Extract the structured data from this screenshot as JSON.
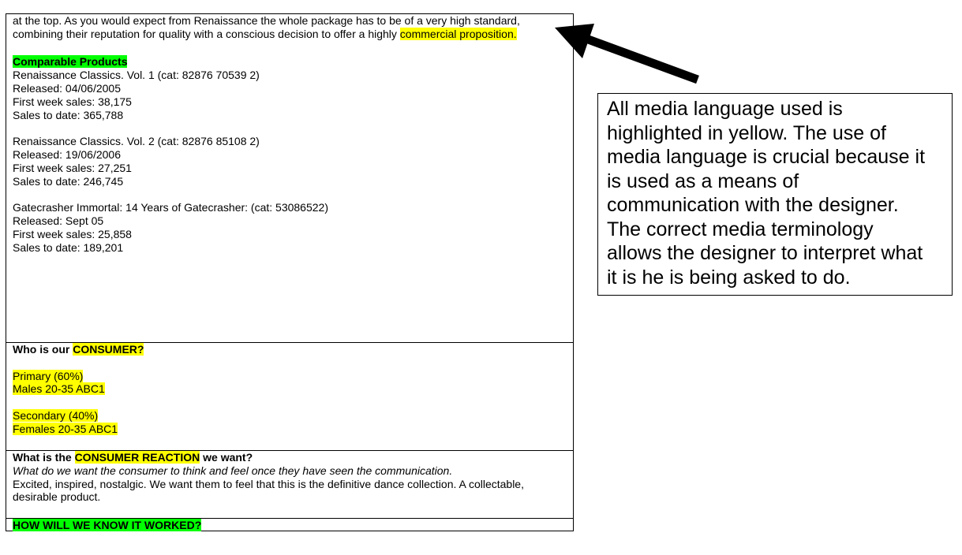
{
  "intro": {
    "line1": "at the top. As you would expect from Renaissance the whole package has to be of a very high standard,",
    "line2_prefix": "combining their reputation for quality with a conscious decision to offer a highly ",
    "line2_highlight": "commercial proposition."
  },
  "comparable": {
    "heading": "Comparable Products",
    "products": [
      {
        "title": "Renaissance Classics. Vol. 1 (cat: 82876 70539 2)",
        "released": "Released: 04/06/2005",
        "first_week": "First week sales: 38,175",
        "to_date": "Sales to date: 365,788"
      },
      {
        "title": "Renaissance Classics. Vol. 2 (cat: 82876 85108 2)",
        "released": "Released: 19/06/2006",
        "first_week": "First week sales: 27,251",
        "to_date": "Sales to date: 246,745"
      },
      {
        "title": "Gatecrasher Immortal: 14 Years of Gatecrasher: (cat: 53086522)",
        "released": "Released: Sept 05",
        "first_week": "First week sales: 25,858",
        "to_date": "Sales to date: 189,201"
      }
    ]
  },
  "consumer": {
    "heading_prefix": "Who is our ",
    "heading_highlight": "CONSUMER?",
    "primary_label": "Primary (60%)",
    "primary_desc": "Males 20-35 ABC1",
    "secondary_label": "Secondary (40%)",
    "secondary_desc": "Females 20-35 ABC1"
  },
  "reaction": {
    "heading_prefix": "What is the ",
    "heading_highlight": "CONSUMER REACTION",
    "heading_suffix": " we want?",
    "question": "What do we want the consumer to think and feel once they have seen the communication.",
    "answer_line1": "Excited, inspired,  nostalgic. We want them to feel that this is the definitive dance collection. A collectable,",
    "answer_line2": "desirable product."
  },
  "worked": {
    "heading": "HOW WILL WE KNOW IT WORKED?"
  },
  "annotation": {
    "lines": [
      "All media language used is",
      "highlighted in yellow. The use of",
      "media language is crucial because it",
      "is used as a means of",
      "communication with the designer.",
      "The correct media terminology",
      "allows the designer to interpret what",
      "it is he is being asked to do."
    ]
  },
  "colors": {
    "yellow_highlight": "#ffff00",
    "green_highlight": "#00ff00"
  }
}
